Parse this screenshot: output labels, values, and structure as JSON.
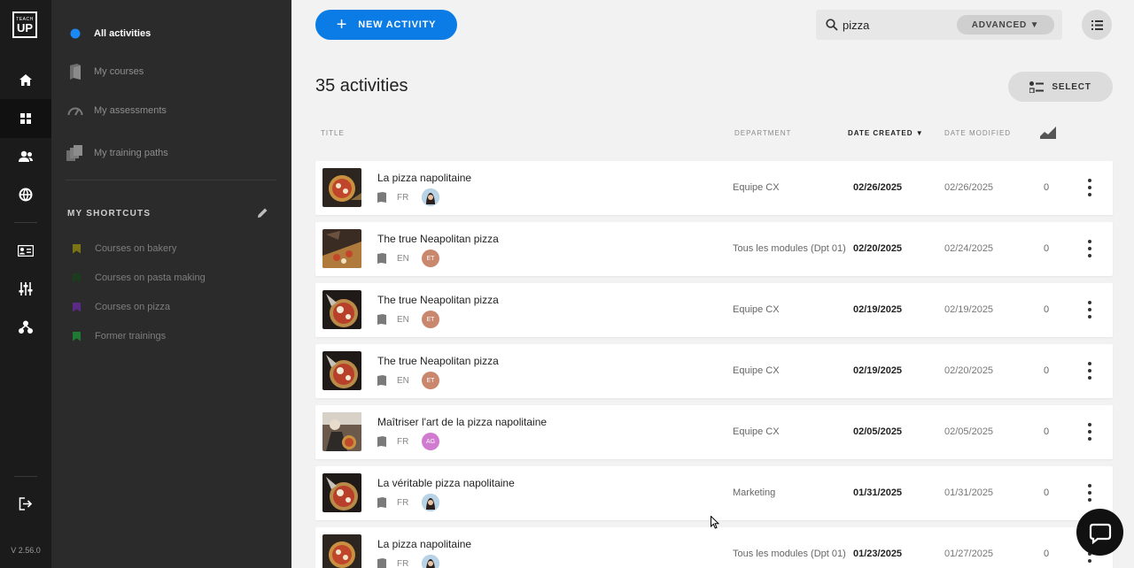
{
  "app": {
    "logo_top": "TEACH",
    "logo_bottom": "UP",
    "version": "V 2.56.0"
  },
  "rail": {
    "icons": [
      "home-icon",
      "dashboard-icon",
      "users-icon",
      "globe-icon",
      "id-card-icon",
      "sliders-icon",
      "org-chart-icon",
      "logout-icon"
    ]
  },
  "sidebar": {
    "nav": [
      {
        "label": "All activities",
        "icon": "dot-icon"
      },
      {
        "label": "My courses",
        "icon": "book-icon"
      },
      {
        "label": "My assessments",
        "icon": "gauge-icon"
      },
      {
        "label": "My training paths",
        "icon": "stack-icon"
      }
    ],
    "shortcuts_title": "MY SHORTCUTS",
    "shortcuts": [
      {
        "label": "Courses on bakery",
        "color": "#7a7414"
      },
      {
        "label": "Courses on pasta making",
        "color": "#1b3d1d"
      },
      {
        "label": "Courses on pizza",
        "color": "#5b2a86"
      },
      {
        "label": "Former trainings",
        "color": "#1f7a34"
      }
    ]
  },
  "toolbar": {
    "new_activity": "NEW ACTIVITY",
    "search_value": "pizza",
    "advanced": "ADVANCED ▼",
    "select": "SELECT"
  },
  "list": {
    "count": "35 activities",
    "columns": {
      "title": "TITLE",
      "department": "DEPARTMENT",
      "date_created": "DATE CREATED ▼",
      "date_modified": "DATE MODIFIED"
    },
    "rows": [
      {
        "title": "La pizza napolitaine",
        "lang": "FR",
        "author": "",
        "author_color": "#9fc3dc",
        "department": "Equipe CX",
        "date_created": "02/26/2025",
        "date_modified": "02/26/2025",
        "views": "0"
      },
      {
        "title": "The true Neapolitan pizza",
        "lang": "EN",
        "author": "ET",
        "author_color": "#c9876e",
        "department": "Tous les modules (Dpt 01)",
        "date_created": "02/20/2025",
        "date_modified": "02/24/2025",
        "views": "0"
      },
      {
        "title": "The true Neapolitan pizza",
        "lang": "EN",
        "author": "ET",
        "author_color": "#c9876e",
        "department": "Equipe CX",
        "date_created": "02/19/2025",
        "date_modified": "02/19/2025",
        "views": "0"
      },
      {
        "title": "The true Neapolitan pizza",
        "lang": "EN",
        "author": "ET",
        "author_color": "#c9876e",
        "department": "Equipe CX",
        "date_created": "02/19/2025",
        "date_modified": "02/20/2025",
        "views": "0"
      },
      {
        "title": "Maîtriser l'art de la pizza napolitaine",
        "lang": "FR",
        "author": "AG",
        "author_color": "#d07ad0",
        "department": "Equipe CX",
        "date_created": "02/05/2025",
        "date_modified": "02/05/2025",
        "views": "0"
      },
      {
        "title": "La véritable pizza napolitaine",
        "lang": "FR",
        "author": "",
        "author_color": "#9fc3dc",
        "department": "Marketing",
        "date_created": "01/31/2025",
        "date_modified": "01/31/2025",
        "views": "0"
      },
      {
        "title": "La pizza napolitaine",
        "lang": "FR",
        "author": "",
        "author_color": "#9fc3dc",
        "department": "Tous les modules (Dpt 01)",
        "date_created": "01/23/2025",
        "date_modified": "01/27/2025",
        "views": "0"
      }
    ]
  }
}
